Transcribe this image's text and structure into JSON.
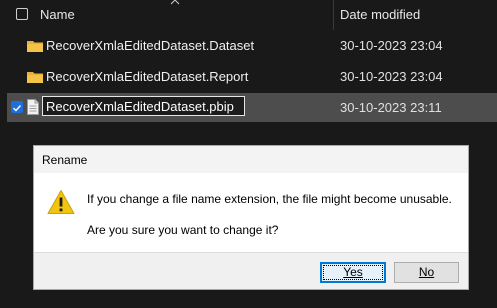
{
  "header": {
    "name_label": "Name",
    "date_label": "Date modified"
  },
  "files": [
    {
      "name": "RecoverXmlaEditedDataset.Dataset",
      "date": "30-10-2023 23:04",
      "type": "folder-icon"
    },
    {
      "name": "RecoverXmlaEditedDataset.Report",
      "date": "30-10-2023 23:04",
      "type": "folder-icon"
    }
  ],
  "selected_file": {
    "name_value": "RecoverXmlaEditedDataset.pbip",
    "date": "30-10-2023 23:11",
    "type": "file-icon"
  },
  "dialog": {
    "title": "Rename",
    "message": "If you change a file name extension, the file might become unusable.",
    "question": "Are you sure you want to change it?",
    "yes_label": "Yes",
    "no_label": "No",
    "icon": "warning-icon"
  },
  "colors": {
    "background": "#191919",
    "selected_row": "#4d4d4d",
    "folder": "#f4c447",
    "accent": "#0078d4",
    "warning": "#f2c40f"
  }
}
